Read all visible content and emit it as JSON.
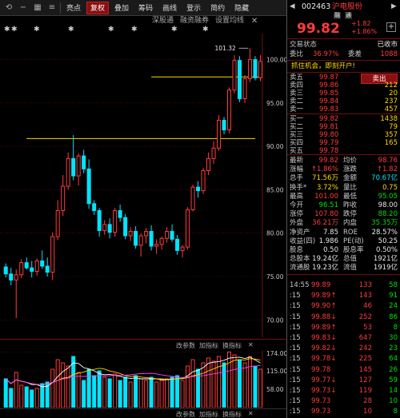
{
  "toolbar": {
    "items": [
      "亮点",
      "复权",
      "叠加",
      "筹码",
      "画线",
      "登示",
      "简约",
      "隐藏"
    ],
    "active_index": 1
  },
  "subbar": {
    "items": [
      "深股通",
      "融资融券",
      "设置均线"
    ]
  },
  "chart": {
    "price_ticks": [
      "100.00",
      "95.00",
      "90.00",
      "85.00",
      "80.00",
      "75.00",
      "70.00"
    ],
    "high_label": "101.32",
    "vol_ticks": [
      "174.00",
      "115.00",
      "58.00"
    ],
    "vol_toolbar": [
      "改参数",
      "加指标",
      "换指标"
    ],
    "bottom_bar": [
      "改参数",
      "加指标",
      "换指标"
    ],
    "colors": {
      "up": "#ff3b3b",
      "down": "#00e5ff",
      "ma_yellow": "#ffd700",
      "grid_red": "#6a1010"
    }
  },
  "chart_data": {
    "type": "candlestick",
    "ylim": [
      68,
      103
    ],
    "candles": [
      [
        76.1,
        76.5,
        74.9,
        75.3
      ],
      [
        75.3,
        76.0,
        74.0,
        74.6
      ],
      [
        74.6,
        75.8,
        70.2,
        75.2
      ],
      [
        75.2,
        77.0,
        74.8,
        76.6
      ],
      [
        76.6,
        77.2,
        75.8,
        76.0
      ],
      [
        76.0,
        76.8,
        74.9,
        75.6
      ],
      [
        75.6,
        77.1,
        75.1,
        76.8
      ],
      [
        76.8,
        78.0,
        75.9,
        76.2
      ],
      [
        76.2,
        77.2,
        75.0,
        75.5
      ],
      [
        75.5,
        80.1,
        74.6,
        79.6
      ],
      [
        79.6,
        83.8,
        79.2,
        82.6
      ],
      [
        82.6,
        86.7,
        82.0,
        85.4
      ],
      [
        85.4,
        89.3,
        85.0,
        88.6
      ],
      [
        88.6,
        91.3,
        86.1,
        86.6
      ],
      [
        86.6,
        89.2,
        85.5,
        88.9
      ],
      [
        88.9,
        89.6,
        86.9,
        87.4
      ],
      [
        87.4,
        88.5,
        82.8,
        83.4
      ],
      [
        83.4,
        83.8,
        82.1,
        82.6
      ],
      [
        82.6,
        82.9,
        79.6,
        80.3
      ],
      [
        80.3,
        81.5,
        79.8,
        81.0
      ],
      [
        81.0,
        81.7,
        79.4,
        80.1
      ],
      [
        80.1,
        82.9,
        79.6,
        82.6
      ],
      [
        82.6,
        83.3,
        81.3,
        81.8
      ],
      [
        81.8,
        82.2,
        79.3,
        79.7
      ],
      [
        79.7,
        80.7,
        79.1,
        80.2
      ],
      [
        80.2,
        80.8,
        78.2,
        78.6
      ],
      [
        78.6,
        80.0,
        77.3,
        79.7
      ],
      [
        79.7,
        80.6,
        78.8,
        80.2
      ],
      [
        80.2,
        80.9,
        78.0,
        78.5
      ],
      [
        78.5,
        79.3,
        77.6,
        78.7
      ],
      [
        78.7,
        79.6,
        78.1,
        79.4
      ],
      [
        79.4,
        80.7,
        78.9,
        80.2
      ],
      [
        80.2,
        81.0,
        79.0,
        79.3
      ],
      [
        79.3,
        79.8,
        77.5,
        78.0
      ],
      [
        78.0,
        78.6,
        77.2,
        78.4
      ],
      [
        78.4,
        83.0,
        78.1,
        82.7
      ],
      [
        82.7,
        85.6,
        82.5,
        85.3
      ],
      [
        85.3,
        86.0,
        84.1,
        84.9
      ],
      [
        84.9,
        87.5,
        84.5,
        87.2
      ],
      [
        87.2,
        89.3,
        86.7,
        88.6
      ],
      [
        88.6,
        90.6,
        88.0,
        89.8
      ],
      [
        89.8,
        93.6,
        89.5,
        93.0
      ],
      [
        93.0,
        93.4,
        91.4,
        91.9
      ],
      [
        91.9,
        96.8,
        91.5,
        96.5
      ],
      [
        96.5,
        100.5,
        96.1,
        99.9
      ],
      [
        99.9,
        100.4,
        95.1,
        95.5
      ],
      [
        95.5,
        98.2,
        95.0,
        97.8
      ],
      [
        97.8,
        101.3,
        97.4,
        100.0
      ],
      [
        100.0,
        100.4,
        97.6,
        97.9
      ],
      [
        97.9,
        100.5,
        97.5,
        99.8
      ]
    ],
    "ma_lines": [
      {
        "name": "",
        "color": "#ffd700",
        "from": 5,
        "to": 48,
        "value": 90.9
      },
      {
        "name": "",
        "color": "#ffd700",
        "from": 29,
        "to": 49,
        "value": 98.0
      }
    ],
    "volumes": [
      90,
      60,
      110,
      70,
      65,
      55,
      60,
      75,
      80,
      120,
      150,
      140,
      130,
      160,
      110,
      85,
      120,
      100,
      115,
      95,
      90,
      105,
      85,
      95,
      80,
      100,
      90,
      85,
      95,
      80,
      85,
      90,
      95,
      100,
      85,
      130,
      150,
      120,
      140,
      155,
      145,
      160,
      140,
      174,
      165,
      150,
      140,
      160,
      130,
      120
    ]
  },
  "panel": {
    "code": "002463",
    "name": "沪电股份",
    "badges": [
      "融",
      "通"
    ],
    "price": "99.82",
    "change": "+1.82",
    "change_pct": "+1.86%",
    "status": "交易状态",
    "status_value": "已收市",
    "weibi_label": "委比",
    "weibi": "36.97%",
    "weicha_label": "委差",
    "weicha": "1088",
    "promo": "抓住机会，即刻开户!",
    "sell_label": "卖出",
    "asks": [
      [
        "卖五",
        "99.87",
        ""
      ],
      [
        "卖四",
        "99.86",
        "212"
      ],
      [
        "卖三",
        "99.85",
        "20"
      ],
      [
        "卖二",
        "99.84",
        "237"
      ],
      [
        "卖一",
        "99.83",
        "457"
      ]
    ],
    "bids": [
      [
        "买一",
        "99.82",
        "1438"
      ],
      [
        "买二",
        "99.81",
        "79"
      ],
      [
        "买三",
        "99.80",
        "357"
      ],
      [
        "买四",
        "99.79",
        "165"
      ],
      [
        "买五",
        "99.78",
        ""
      ]
    ],
    "stats": [
      [
        "最新",
        "99.82",
        "red",
        "均价",
        "98.76",
        "red"
      ],
      [
        "涨幅",
        "↑1.86%",
        "red",
        "涨跌",
        "↑1.82",
        "red"
      ],
      [
        "总手",
        "71.56万",
        "yellow",
        "金额",
        "70.67亿",
        "cyan"
      ],
      [
        "换手*",
        "3.72%",
        "yellow",
        "量比",
        "0.75",
        "yellow"
      ],
      [
        "最高",
        "101.00",
        "red",
        "最低",
        "95.05",
        "green"
      ],
      [
        "今开",
        "96.51",
        "green",
        "昨收",
        "98.00",
        "white"
      ],
      [
        "涨停",
        "107.80",
        "red",
        "跌停",
        "88.20",
        "green"
      ],
      [
        "外盘",
        "36.21万",
        "red",
        "内盘",
        "35.35万",
        "green"
      ],
      [
        "净资产",
        "7.85",
        "white",
        "ROE",
        "28.57%",
        "white"
      ],
      [
        "收益(四)",
        "1.986",
        "white",
        "PE(动)",
        "50.25",
        "white"
      ],
      [
        "股息",
        "0.50",
        "white",
        "股息率",
        "0.50%",
        "white"
      ],
      [
        "总股本",
        "19.24亿",
        "white",
        "总值",
        "1921亿",
        "white"
      ],
      [
        "流通股",
        "19.23亿",
        "white",
        "流值",
        "1919亿",
        "white"
      ]
    ],
    "ticks": [
      [
        "14:55",
        "99.89",
        "133",
        "58"
      ],
      [
        ":15",
        "99.89↑",
        "143",
        "91"
      ],
      [
        ":15",
        "99.90↑",
        "46",
        "24"
      ],
      [
        ":15",
        "99.88↓",
        "252",
        "86"
      ],
      [
        ":15",
        "99.89↑",
        "53",
        "8"
      ],
      [
        ":15",
        "99.83↓",
        "647",
        "30"
      ],
      [
        ":15",
        "99.82↓",
        "242",
        "23"
      ],
      [
        ":15",
        "99.78↓",
        "225",
        "64"
      ],
      [
        ":15",
        "99.78",
        "145",
        "26"
      ],
      [
        ":15",
        "99.77↓",
        "127",
        "59"
      ],
      [
        ":15",
        "99.73↓",
        "119",
        "14"
      ],
      [
        ":15",
        "99.73",
        "28",
        "10"
      ],
      [
        ":15",
        "99.73",
        "10",
        "8"
      ]
    ]
  }
}
